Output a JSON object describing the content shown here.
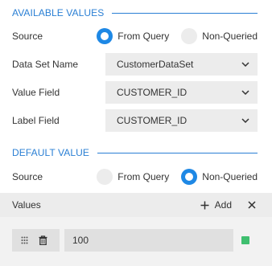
{
  "available_values": {
    "title": "AVAILABLE VALUES",
    "source_label": "Source",
    "source_options": [
      {
        "label": "From Query",
        "selected": true
      },
      {
        "label": "Non-Queried",
        "selected": false
      }
    ],
    "dataset_label": "Data Set Name",
    "dataset_value": "CustomerDataSet",
    "value_field_label": "Value Field",
    "value_field_value": "CUSTOMER_ID",
    "label_field_label": "Label Field",
    "label_field_value": "CUSTOMER_ID"
  },
  "default_value": {
    "title": "DEFAULT VALUE",
    "source_label": "Source",
    "source_options": [
      {
        "label": "From Query",
        "selected": false
      },
      {
        "label": "Non-Queried",
        "selected": true
      }
    ]
  },
  "values": {
    "title": "Values",
    "add_label": "Add",
    "items": [
      {
        "value": "100",
        "status_color": "#3fbf6f"
      }
    ]
  },
  "colors": {
    "accent": "#2a7fd4",
    "radio_selected": "#1e88e5",
    "field_bg": "#ececec",
    "status_ok": "#3fbf6f"
  },
  "icons": [
    "chevron-down-icon",
    "plus-icon",
    "close-icon",
    "drag-handle-icon",
    "trash-icon"
  ]
}
